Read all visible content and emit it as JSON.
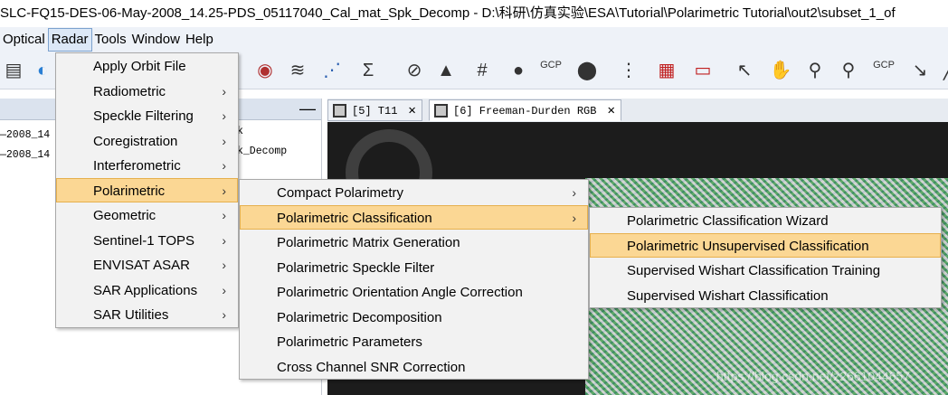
{
  "window": {
    "title": "SLC-FQ15-DES-06-May-2008_14.25-PDS_05117040_Cal_mat_Spk_Decomp - D:\\科研\\仿真实验\\ESA\\Tutorial\\Polarimetric Tutorial\\out2\\subset_1_of"
  },
  "menubar": {
    "items": [
      "Optical",
      "Radar",
      "Tools",
      "Window",
      "Help"
    ]
  },
  "left_panel": {
    "rows": [
      "—2008_14",
      "—2008_14"
    ],
    "right_rows": [
      "k",
      "k_Decomp"
    ],
    "minimize": "—"
  },
  "tabs": [
    {
      "label": "[5] T11",
      "close": "✕"
    },
    {
      "label": "[6] Freeman-Durden RGB",
      "close": "✕"
    }
  ],
  "radar_menu": [
    {
      "label": "Apply Orbit File",
      "submenu": false
    },
    {
      "label": "Radiometric",
      "submenu": true
    },
    {
      "label": "Speckle Filtering",
      "submenu": true
    },
    {
      "label": "Coregistration",
      "submenu": true
    },
    {
      "label": "Interferometric",
      "submenu": true
    },
    {
      "label": "Polarimetric",
      "submenu": true,
      "highlighted": true
    },
    {
      "label": "Geometric",
      "submenu": true
    },
    {
      "label": "Sentinel-1 TOPS",
      "submenu": true
    },
    {
      "label": "ENVISAT ASAR",
      "submenu": true
    },
    {
      "label": "SAR Applications",
      "submenu": true
    },
    {
      "label": "SAR Utilities",
      "submenu": true
    }
  ],
  "polarimetric_menu": [
    {
      "label": "Compact Polarimetry",
      "submenu": true
    },
    {
      "label": "Polarimetric Classification",
      "submenu": true,
      "highlighted": true
    },
    {
      "label": "Polarimetric Matrix Generation",
      "submenu": false
    },
    {
      "label": "Polarimetric Speckle Filter",
      "submenu": false
    },
    {
      "label": "Polarimetric Orientation Angle Correction",
      "submenu": false
    },
    {
      "label": "Polarimetric Decomposition",
      "submenu": false
    },
    {
      "label": "Polarimetric Parameters",
      "submenu": false
    },
    {
      "label": "Cross Channel SNR Correction",
      "submenu": false
    }
  ],
  "classification_menu": [
    {
      "label": "Polarimetric Classification Wizard"
    },
    {
      "label": "Polarimetric Unsupervised Classification",
      "highlighted": true
    },
    {
      "label": "Supervised Wishart Classification Training"
    },
    {
      "label": "Supervised Wishart Classification"
    }
  ],
  "toolbar_labels": {
    "gcp1": "GCP",
    "gcp2": "GCP",
    "sigma": "Σ"
  },
  "arrow_glyph": "›",
  "watermark": "https://blog.csdn.net/z2661044657",
  "colors": {
    "highlight": "#fbd794",
    "menu_bg": "#f2f2f2"
  }
}
